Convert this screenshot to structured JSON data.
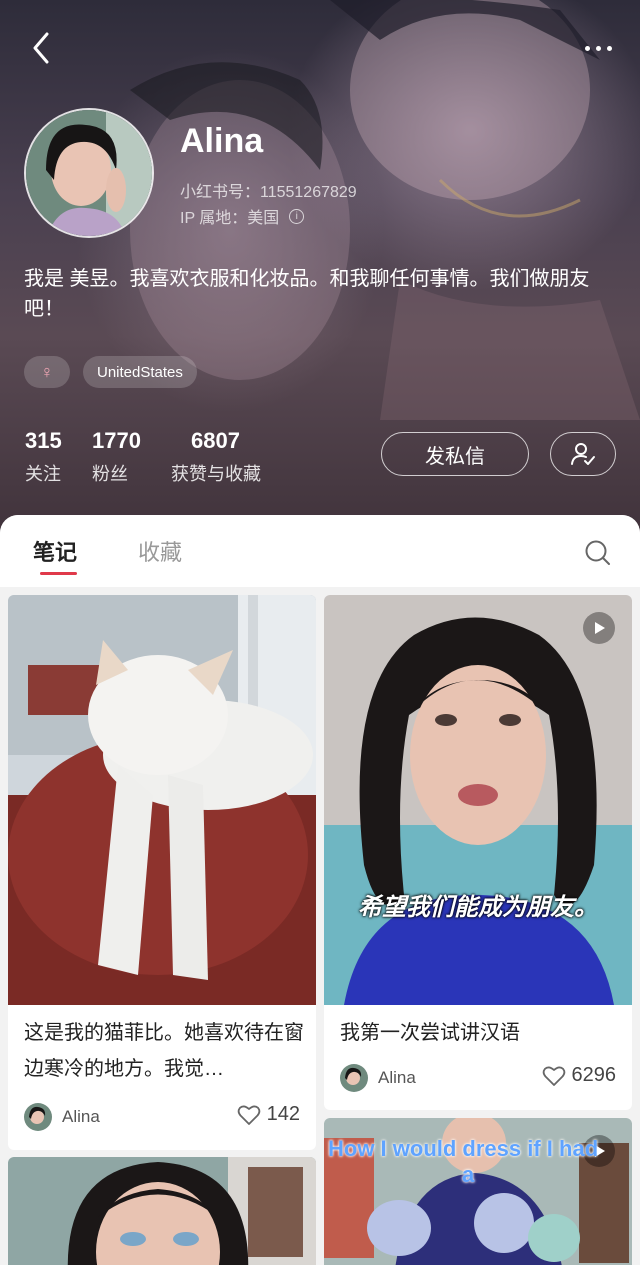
{
  "profile": {
    "name": "Alina",
    "red_id": "小红书号：11551267829",
    "ip_location": "IP 属地：美国",
    "bio": "我是 美昱。我喜欢衣服和化妆品。和我聊任何事情。我们做朋友吧！",
    "gender_symbol": "♀",
    "country_tag": "UnitedStates"
  },
  "stats": [
    {
      "value": "315",
      "label": "关注"
    },
    {
      "value": "1770",
      "label": "粉丝"
    },
    {
      "value": "6807",
      "label": "获赞与收藏"
    }
  ],
  "actions": {
    "message_label": "发私信"
  },
  "tabs": {
    "notes": "笔记",
    "collections": "收藏"
  },
  "notes": [
    {
      "title": "这是我的猫菲比。她喜欢待在窗边寒冷的地方。我觉…",
      "author": "Alina",
      "likes": "142"
    },
    {
      "title": "我第一次尝试讲汉语",
      "author": "Alina",
      "likes": "6296",
      "overlay": "希望我们能成为朋友。"
    },
    {
      "overlay_line1": "How I would dress if I had",
      "overlay_line2": "a"
    }
  ],
  "colors": {
    "accent": "#e0394a",
    "page_bg": "#f2f2f2"
  },
  "icons": [
    "back-icon",
    "more-icon",
    "info-icon",
    "female-icon",
    "follow-user-icon",
    "search-icon",
    "heart-icon",
    "play-icon"
  ]
}
